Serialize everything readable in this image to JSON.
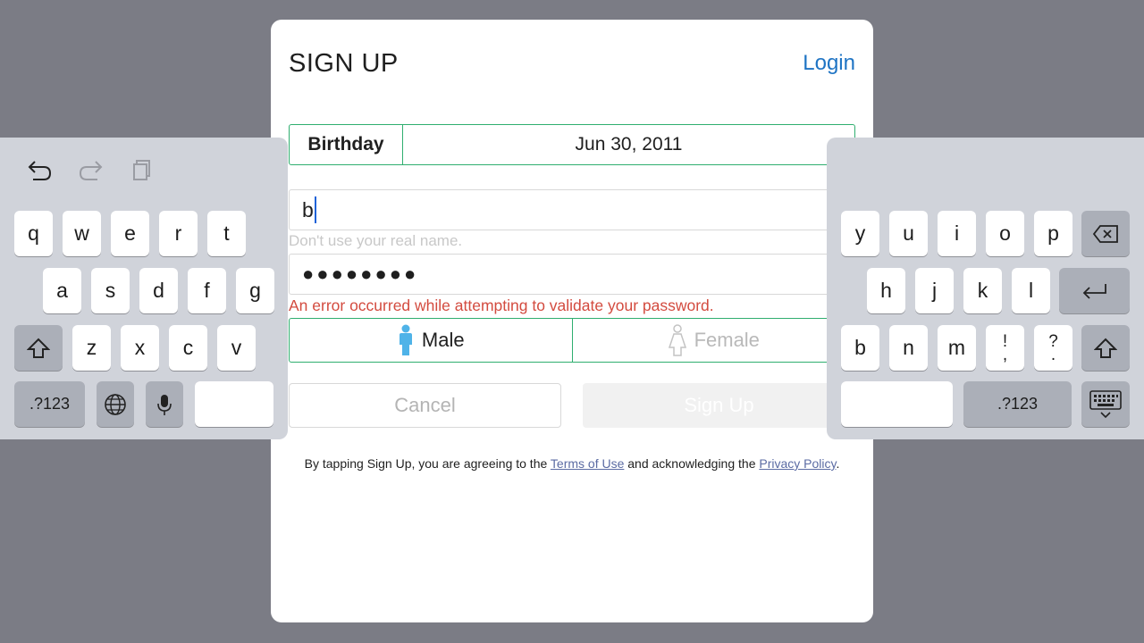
{
  "signup": {
    "title": "SIGN UP",
    "login_link": "Login",
    "birthday": {
      "label": "Birthday",
      "value": "Jun 30, 2011"
    },
    "username": {
      "value": "b",
      "hint": "Don't use your real name."
    },
    "password": {
      "masked_value": "●●●●●●●●",
      "error": "An error occurred while attempting to validate your password."
    },
    "gender": {
      "male_label": "Male",
      "female_label": "Female",
      "selected": "Male"
    },
    "buttons": {
      "cancel": "Cancel",
      "signup": "Sign Up"
    },
    "legal": {
      "prefix": "By tapping Sign Up, you are agreeing to the ",
      "terms_link": "Terms of Use",
      "middle": " and acknowledging the ",
      "privacy_link": "Privacy Policy",
      "suffix": "."
    }
  },
  "keyboard": {
    "left": {
      "row1": [
        "q",
        "w",
        "e",
        "r",
        "t"
      ],
      "row2": [
        "a",
        "s",
        "d",
        "f",
        "g"
      ],
      "row3": [
        "z",
        "x",
        "c",
        "v"
      ],
      "numbers_key": ".?123"
    },
    "right": {
      "row1": [
        "y",
        "u",
        "i",
        "o",
        "p"
      ],
      "row2": [
        "h",
        "j",
        "k",
        "l"
      ],
      "row3": [
        "b",
        "n",
        "m"
      ],
      "punct1_top": "!",
      "punct1_bottom": ",",
      "punct2_top": "?",
      "punct2_bottom": ".",
      "numbers_key": ".?123"
    },
    "icons": [
      "undo-icon",
      "redo-icon",
      "paste-icon",
      "shift-icon",
      "globe-icon",
      "microphone-icon",
      "backspace-icon",
      "return-icon",
      "hide-keyboard-icon"
    ]
  },
  "colors": {
    "background": "#7b7c85",
    "accent_green": "#2fae6f",
    "link_blue": "#1f74c4",
    "error_red": "#d34b3f",
    "male_icon": "#4fb3e8",
    "keyboard_bg": "#d0d3da"
  }
}
